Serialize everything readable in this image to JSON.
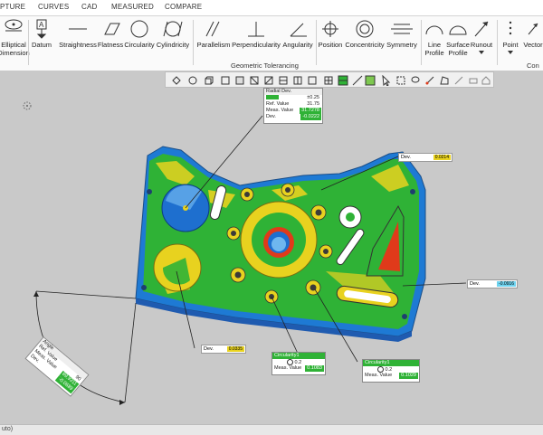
{
  "menu": {
    "tabs": [
      "PTURE",
      "CURVES",
      "CAD",
      "MEASURED",
      "COMPARE"
    ]
  },
  "ribbon": {
    "tools": {
      "elliptical": "Elliptical\nDimension",
      "datum": "Datum",
      "straightness": "Straightness",
      "flatness": "Flatness",
      "circularity": "Circularity",
      "cylindricity": "Cylindricity",
      "parallelism": "Parallelism",
      "perpendicularity": "Perpendicularity",
      "angularity": "Angularity",
      "position": "Position",
      "concentricity": "Concentricity",
      "symmetry": "Symmetry",
      "line_profile": "Line\nProfile",
      "surface_profile": "Surface\nProfile",
      "runout": "Runout",
      "point": "Point",
      "vector": "Vector"
    },
    "group_gt": "Geometric Tolerancing",
    "group_cons": "Con"
  },
  "callouts": {
    "radial": {
      "title": "Radial Dev.",
      "rows": [
        {
          "label": "Ref. Value",
          "value": "31.75"
        },
        {
          "label": "Meas. Value",
          "value": "31.7278"
        },
        {
          "label": "Dev.",
          "value": "-0.0222"
        }
      ],
      "tol": "±0.25"
    },
    "dev_top": {
      "label": "Dev.",
      "value": "0.0214"
    },
    "dev_right": {
      "label": "Dev.",
      "value": "-0.0916"
    },
    "dev_left": {
      "label": "Dev.",
      "value": "0.0335"
    },
    "circ1": {
      "title": "Circularity1",
      "tol": "0.2",
      "label": "Meas. Value",
      "value": "0.1083"
    },
    "circ2": {
      "title": "Circularity1",
      "tol": "0.2",
      "label": "Meas. Value",
      "value": "0.1029"
    },
    "angle": {
      "title": "Angle",
      "rows": [
        {
          "label": "Ref. Value",
          "value": "90"
        },
        {
          "label": "Meas. Value",
          "value": "89.9311"
        },
        {
          "label": "Dev.",
          "value": "-0.0689"
        }
      ]
    }
  },
  "status": "uto)",
  "colors": {
    "green": "#2fb236",
    "yellow": "#e8d21f",
    "blue": "#1e6fcf",
    "red": "#e03a1a",
    "panel": "#c9c9c9"
  }
}
